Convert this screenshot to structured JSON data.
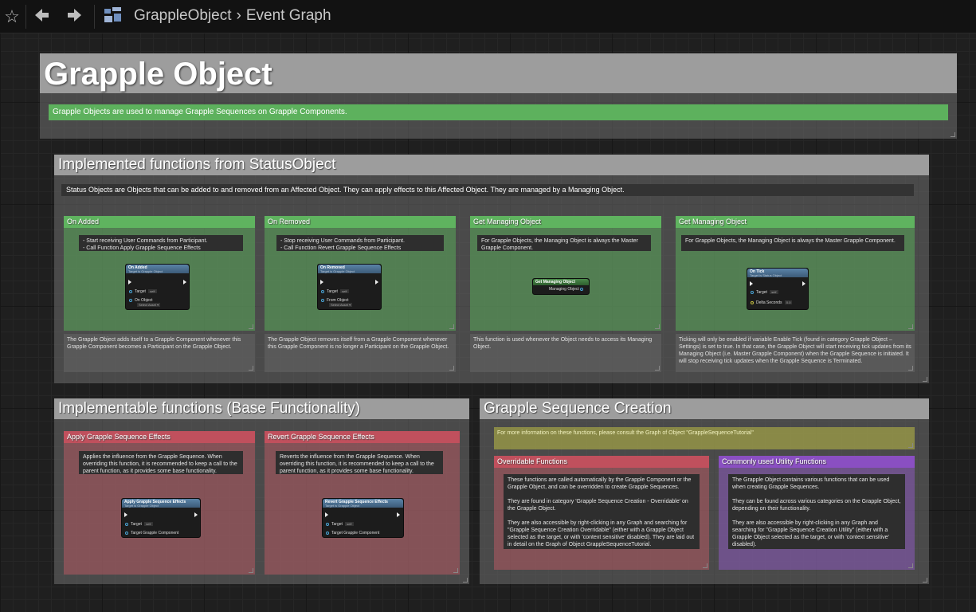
{
  "toolbar": {
    "breadcrumb_root": "GrappleObject",
    "breadcrumb_sep": "›",
    "breadcrumb_current": "Event Graph"
  },
  "title_box": {
    "title": "Grapple Object",
    "note": "Grapple Objects are used to manage Grapple Sequences on Grapple Components."
  },
  "status_box": {
    "title": "Implemented functions from StatusObject",
    "note": "Status Objects are Objects that can be added to and removed from an Affected Object. They can apply effects to this Affected Object. They are managed by a Managing Object.",
    "cards": [
      {
        "title": "On Added",
        "note_lines": [
          "-  Start receiving User Commands from Participant.",
          "-  Call Function Apply Grapple Sequence Effects"
        ],
        "node_title": "On Added",
        "node_sub": "Target is Grapple Object",
        "pin_target": "Target",
        "pin_target_val": "self",
        "pin_extra": "On Object",
        "pin_extra_val": "Select Asset ▾",
        "desc": "The Grapple Object adds itself to a Grapple Component whenever this Grapple Component becomes a Participant on the Grapple Object."
      },
      {
        "title": "On Removed",
        "note_lines": [
          "-  Stop receiving User Commands from Participant.",
          "-  Call Function Revert Grapple Sequence Effects"
        ],
        "node_title": "On Removed",
        "node_sub": "Target is Grapple Object",
        "pin_target": "Target",
        "pin_target_val": "self",
        "pin_extra": "From Object",
        "pin_extra_val": "Select Asset ▾",
        "desc": "The Grapple Object removes itself from a Grapple Component whenever this Grapple Component is no longer a Participant on the Grapple Object."
      },
      {
        "title": "Get Managing Object",
        "note_lines": [
          "For Grapple Objects, the Managing Object is always the Master Grapple Component."
        ],
        "node_title": "Get Managing Object",
        "node_out": "Managing Object",
        "desc": "This function is used whenever the Object needs to access its Managing Object."
      },
      {
        "title": "Get Managing Object",
        "note_lines": [
          "For Grapple Objects, the Managing Object is always the Master Grapple Component."
        ],
        "node_title": "On Tick",
        "node_sub": "Target is Status Object",
        "pin_target": "Target",
        "pin_target_val": "self",
        "pin_extra": "Delta Seconds",
        "pin_extra_val": "0.0",
        "desc": "Ticking will only be enabled if variable Enable Tick (found in category Grapple Object – Settings) is set to true. In that case, the Grapple Object will start receiving tick updates from its Managing Object (i.e. Master Grapple Component) when the Grapple Sequence is initiated. It will stop receiving tick updates when the Grapple Sequence is Terminated."
      }
    ]
  },
  "base_box": {
    "title": "Implementable functions (Base Functionality)",
    "cards": [
      {
        "title": "Apply Grapple Sequence Effects",
        "note": "Applies the influence from the Grapple Sequence. When overriding this function, it is recommended to keep a call to the parent function, as it provides some base functionality.",
        "node_title": "Apply Grapple Sequence Effects",
        "node_sub": "Target is Grapple Object",
        "pin_target": "Target",
        "pin_target_val": "self",
        "pin_extra": "Target Grapple Component"
      },
      {
        "title": "Revert Grapple Sequence Effects",
        "note": "Reverts the influence from the Grapple Sequence. When overriding this function, it is recommended to keep a call to the parent function, as it provides some base functionality.",
        "node_title": "Revert Grapple Sequence Effects",
        "node_sub": "Target is Grapple Object",
        "pin_target": "Target",
        "pin_target_val": "self",
        "pin_extra": "Target Grapple Component"
      }
    ]
  },
  "creation_box": {
    "title": "Grapple Sequence Creation",
    "yellow_note": "For more information on these functions, please consult the Graph of Object \"GrappleSequenceTutorial\"",
    "overridable": {
      "title": "Overridable Functions",
      "p1": "These functions are called automatically by the Grapple Component or the Grapple Object, and can be overridden to create Grapple Sequences.",
      "p2": "They are found in category 'Grapple Sequence Creation - Overridable' on the Grapple Object.",
      "p3": "They are also accessible by right-clicking in any Graph and searching for \"Grapple Sequence Creation Overridable\" (either with a Grapple Object selected as the target, or with 'context sensitive' disabled). They are laid out in detail on the Graph of Object GrappleSequenceTutorial."
    },
    "utility": {
      "title": "Commonly used Utility Functions",
      "p1": "The Grapple Object contains various functions that can be used when creating Grapple Sequences.",
      "p2": "They can be found across various categories on the Grapple Object, depending on their functionality.",
      "p3": "They are also accessible by right-clicking in any Graph and searching for \"Grapple Sequence Creation Utility\" (either with a Grapple Object selected as the target, or with 'context sensitive' disabled)."
    }
  }
}
